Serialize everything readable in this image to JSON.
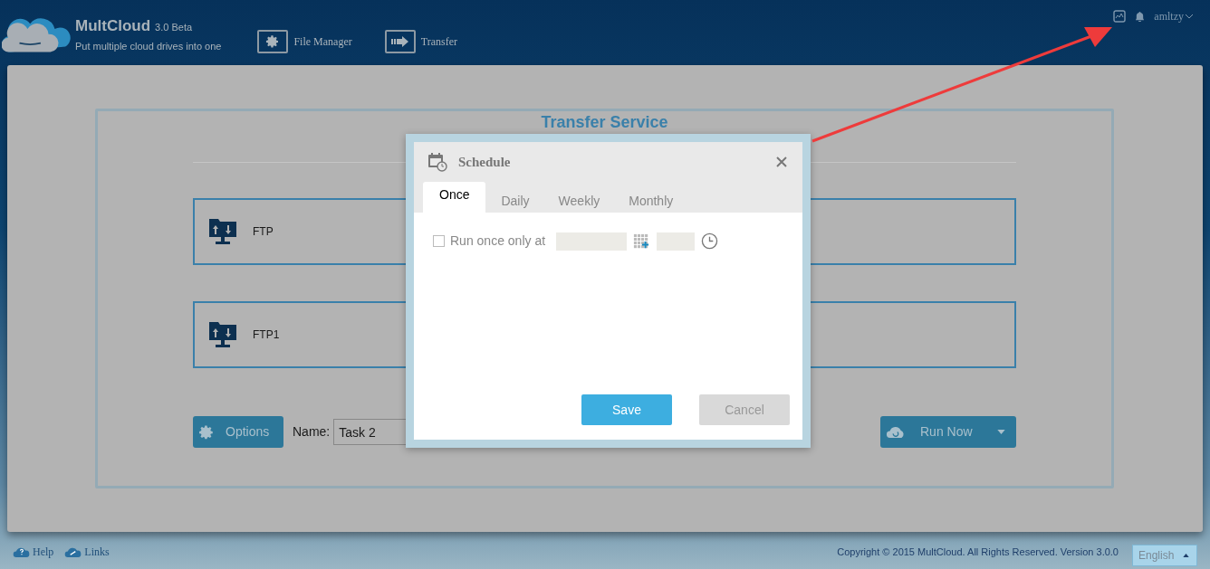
{
  "header": {
    "brand": "MultCloud",
    "version": "3.0 Beta",
    "tagline": "Put multiple cloud drives into one",
    "nav": [
      {
        "label": "File Manager",
        "kind": "gear"
      },
      {
        "label": "Transfer",
        "kind": "arrow"
      }
    ],
    "user": "amltzy"
  },
  "transfer_service": {
    "title": "Transfer Service",
    "sources": [
      {
        "label": "FTP"
      },
      {
        "label": "FTP1"
      }
    ],
    "options_button": "Options",
    "name_label": "Name:",
    "name_value": "Task 2",
    "run_button": "Run Now"
  },
  "dialog": {
    "title": "Schedule",
    "tabs": [
      {
        "label": "Once",
        "selected": true
      },
      {
        "label": "Daily",
        "selected": false
      },
      {
        "label": "Weekly",
        "selected": false
      },
      {
        "label": "Monthly",
        "selected": false
      }
    ],
    "run_once": {
      "label": "Run once only at",
      "checked": false
    },
    "buttons": [
      {
        "label": "Save",
        "kind": "primary"
      },
      {
        "label": "Cancel",
        "kind": "secondary"
      }
    ]
  },
  "footer": {
    "links": [
      {
        "label": "Help",
        "kind": "help"
      },
      {
        "label": "Links",
        "kind": "link"
      }
    ],
    "copyright": "Copyright © 2015 MultCloud. All Rights Reserved. Version 3.0.0",
    "language": "English"
  }
}
